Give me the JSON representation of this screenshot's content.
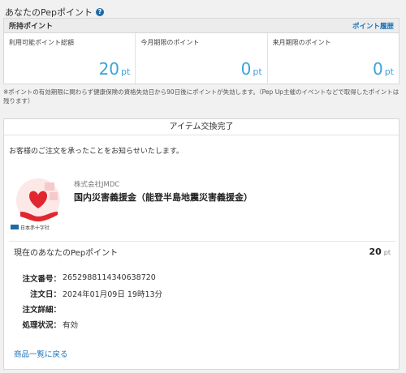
{
  "page": {
    "title": "あなたのPepポイント",
    "help_icon": "question-circle-icon"
  },
  "points": {
    "header_label": "所持ポイント",
    "history_link": "ポイント履歴",
    "columns": [
      {
        "label": "利用可能ポイント総額",
        "value": "20",
        "unit": "pt"
      },
      {
        "label": "今月期限のポイント",
        "value": "0",
        "unit": "pt"
      },
      {
        "label": "来月期限のポイント",
        "value": "0",
        "unit": "pt"
      }
    ],
    "value_color": "#3ba3d8"
  },
  "note": "※ポイントの有効期限に関わらず健康保険の資格失効日から90日後にポイントが失効します。（Pep Up主催のイベントなどで取得したポイントは残ります）",
  "order": {
    "header": "アイテム交換完了",
    "notice": "お客様のご注文を承ったことをお知らせいたします。",
    "logo_caption": "日本赤十字社",
    "company": "株式会社JMDC",
    "item_name": "国内災害義援金（能登半島地震災害義援金）",
    "current_points_label": "現在のあなたのPepポイント",
    "current_points_value": "20",
    "current_points_unit": "pt",
    "details": [
      {
        "label": "注文番号：",
        "value": "2652988114340638720"
      },
      {
        "label": "注文日：",
        "value": "2024年01月09日 19時13分"
      },
      {
        "label": "注文詳細：",
        "value": ""
      },
      {
        "label": "処理状況：",
        "value": "有効"
      }
    ],
    "back_link": "商品一覧に戻る"
  }
}
